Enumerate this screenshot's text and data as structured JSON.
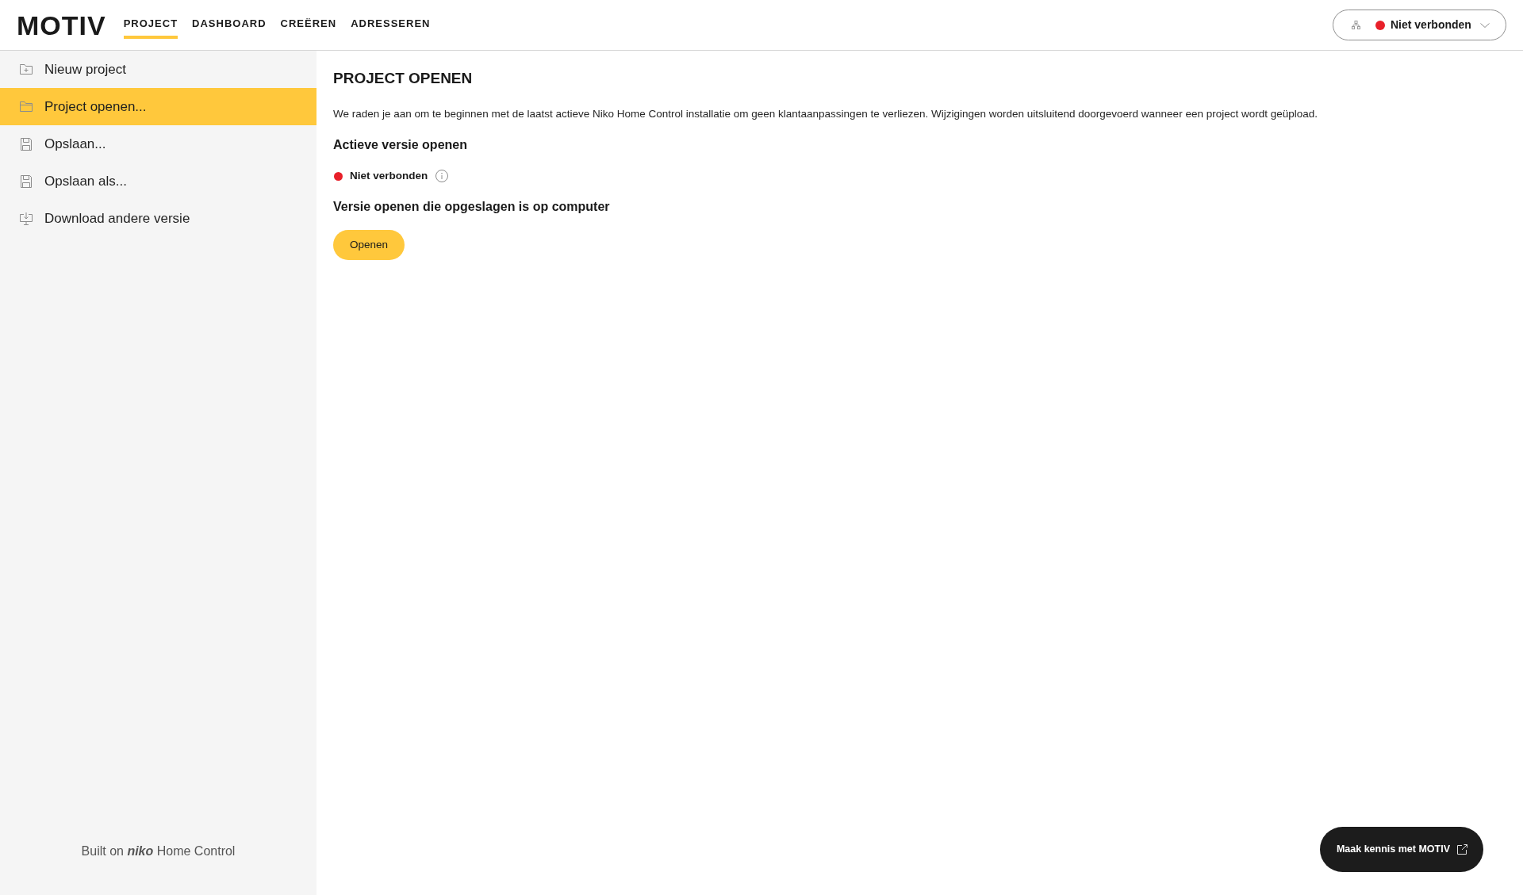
{
  "header": {
    "logo": "MOTIV",
    "nav": [
      {
        "label": "PROJECT",
        "selected": true
      },
      {
        "label": "DASHBOARD",
        "selected": false
      },
      {
        "label": "CREËREN",
        "selected": false
      },
      {
        "label": "ADRESSEREN",
        "selected": false
      }
    ],
    "connection": {
      "status": "Niet verbonden",
      "connected": false
    }
  },
  "sidebar": {
    "items": [
      {
        "label": "Nieuw project",
        "selected": false
      },
      {
        "label": "Project openen...",
        "selected": true
      },
      {
        "label": "Opslaan...",
        "selected": false
      },
      {
        "label": "Opslaan als...",
        "selected": false
      },
      {
        "label": "Download andere versie",
        "selected": false
      }
    ],
    "footer": "Built on **niko** Home Control"
  },
  "main": {
    "title": "PROJECT OPENEN",
    "intro": "We raden je aan om te beginnen met de laatst actieve Niko Home Control installatie om geen klantaanpassingen te verliezen. Wijzigingen worden uitsluitend doorgevoerd wanneer een project wordt geüpload.",
    "active_version": {
      "heading": "Actieve versie openen",
      "status": "Niet verbonden",
      "connected": false
    },
    "local_version": {
      "heading": "Versie openen die opgeslagen is op computer",
      "button": "Openen"
    }
  },
  "promo_button": "Maak kennis met MOTIV"
}
